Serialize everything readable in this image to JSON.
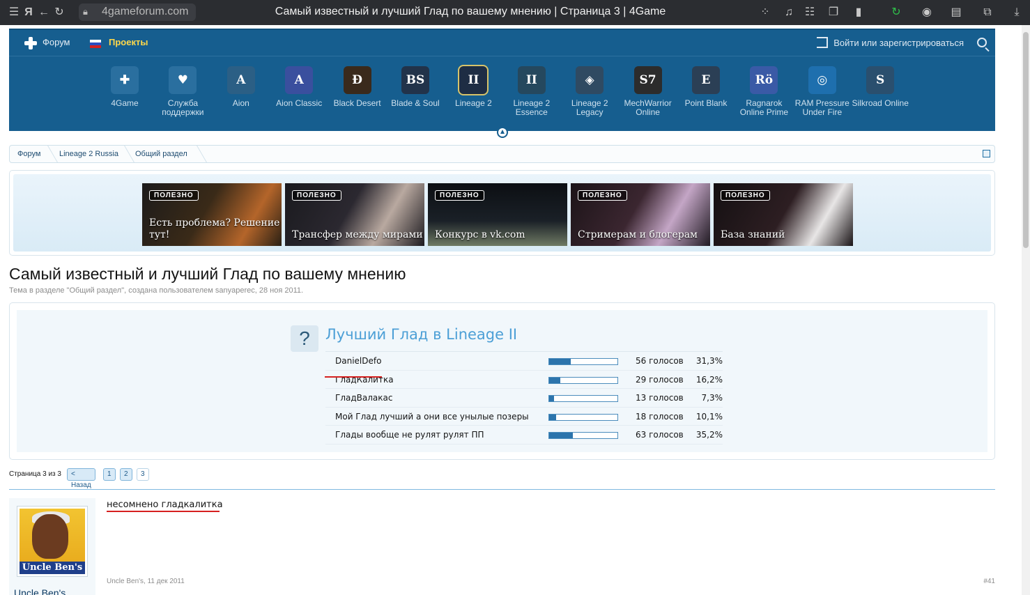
{
  "browser": {
    "url": "4gameforum.com",
    "tab_title": "Самый известный и лучший Глад по вашему мнению | Страница 3 | 4Game"
  },
  "header": {
    "nav_forum": "Форум",
    "nav_projects": "Проекты",
    "login": "Войти или зарегистрироваться",
    "projects": [
      {
        "name": "4Game",
        "icon": "plus-icon",
        "color": "#2a6f9f",
        "glyph": "✚"
      },
      {
        "name": "Служба поддержки",
        "icon": "heart-icon",
        "color": "#2a6f9f",
        "glyph": "♥"
      },
      {
        "name": "Aion",
        "icon": "aion-logo-icon",
        "color": "#2b5f85",
        "glyph": "A"
      },
      {
        "name": "Aion Classic",
        "icon": "aion-classic-logo-icon",
        "color": "#3a4f9e",
        "glyph": "A"
      },
      {
        "name": "Black Desert",
        "icon": "black-desert-logo-icon",
        "color": "#3a2a1c",
        "glyph": "Ð"
      },
      {
        "name": "Blade & Soul",
        "icon": "blade-soul-logo-icon",
        "color": "#22334a",
        "glyph": "BS"
      },
      {
        "name": "Lineage 2",
        "icon": "lineage2-logo-icon",
        "color": "#1e2d44",
        "glyph": "II"
      },
      {
        "name": "Lineage 2 Essence",
        "icon": "lineage2-essence-logo-icon",
        "color": "#25485e",
        "glyph": "II"
      },
      {
        "name": "Lineage 2 Legacy",
        "icon": "lineage2-legacy-logo-icon",
        "color": "#2f4a62",
        "glyph": "◈"
      },
      {
        "name": "MechWarrior Online",
        "icon": "mechwarrior-logo-icon",
        "color": "#2c2c2c",
        "glyph": "S7"
      },
      {
        "name": "Point Blank",
        "icon": "point-blank-logo-icon",
        "color": "#2b3f55",
        "glyph": "E"
      },
      {
        "name": "Ragnarok Online Prime",
        "icon": "ragnarok-logo-icon",
        "color": "#3a5aa6",
        "glyph": "Rö"
      },
      {
        "name": "RAM Pressure Under Fire",
        "icon": "ram-pressure-logo-icon",
        "color": "#1e6fae",
        "glyph": "◎"
      },
      {
        "name": "Silkroad Online",
        "icon": "silkroad-logo-icon",
        "color": "#2a4f6e",
        "glyph": "S"
      }
    ]
  },
  "breadcrumb": [
    "Форум",
    "Lineage 2 Russia",
    "Общий раздел"
  ],
  "banner": {
    "tag": "ПОЛЕЗНО",
    "cards": [
      {
        "caption": "Есть проблема? Решение тут!",
        "bg": "linear-gradient(120deg,#1c1b1a 0%,#3a2a18 45%,#b4652a 75%,#2a2014 100%)"
      },
      {
        "caption": "Трансфер между мирами",
        "bg": "linear-gradient(120deg,#1a1a1e 0%,#2b2830 45%,#b9a9a0 70%,#1c1a1f 100%)"
      },
      {
        "caption": "Конкурс в vk.com",
        "bg": "linear-gradient(180deg,#0c0f13 0%,#1a2027 60%,#6f7a63 100%)"
      },
      {
        "caption": "Стримерам и блогерам",
        "bg": "linear-gradient(120deg,#1c1418 0%,#3b2630 45%,#c4a6c6 70%,#201a22 100%)"
      },
      {
        "caption": "База знаний",
        "bg": "linear-gradient(120deg,#141012 0%,#2d1e22 50%,#e8e6e6 75%,#1a1416 100%)"
      }
    ]
  },
  "thread": {
    "title": "Самый известный и лучший Глад по вашему мнению",
    "desc_prefix": "Тема в разделе \"",
    "desc_section": "Общий раздел",
    "desc_mid": "\", создана пользователем ",
    "desc_user": "sanyaperec",
    "desc_suffix": ", 28 ноя 2011."
  },
  "poll": {
    "question_mark": "?",
    "title": "Лучший Глад в Lineage II",
    "responses": [
      {
        "text": "DanielDefo",
        "votes": "56 голосов",
        "pct": "31,3%",
        "fraction": 0.313
      },
      {
        "text": "ГладКалитка",
        "votes": "29 голосов",
        "pct": "16,2%",
        "fraction": 0.162
      },
      {
        "text": "ГладВалакас",
        "votes": "13 голосов",
        "pct": "7,3%",
        "fraction": 0.073
      },
      {
        "text": "Мой Глад лучший а они все унылые позеры",
        "votes": "18 голосов",
        "pct": "10,1%",
        "fraction": 0.101
      },
      {
        "text": "Глады вообще не рулят рулят ПП",
        "votes": "63 голосов",
        "pct": "35,2%",
        "fraction": 0.352
      }
    ]
  },
  "pagination": {
    "label": "Страница 3 из 3",
    "prev": "< Назад",
    "pages": [
      "1",
      "2",
      "3"
    ]
  },
  "post": {
    "username": "Uncle Ben's",
    "avatar_brand": "Uncle Ben's",
    "message": "несомнено гладкалитка",
    "meta": "Uncle Ben's, 11 дек 2011",
    "number": "#41"
  }
}
